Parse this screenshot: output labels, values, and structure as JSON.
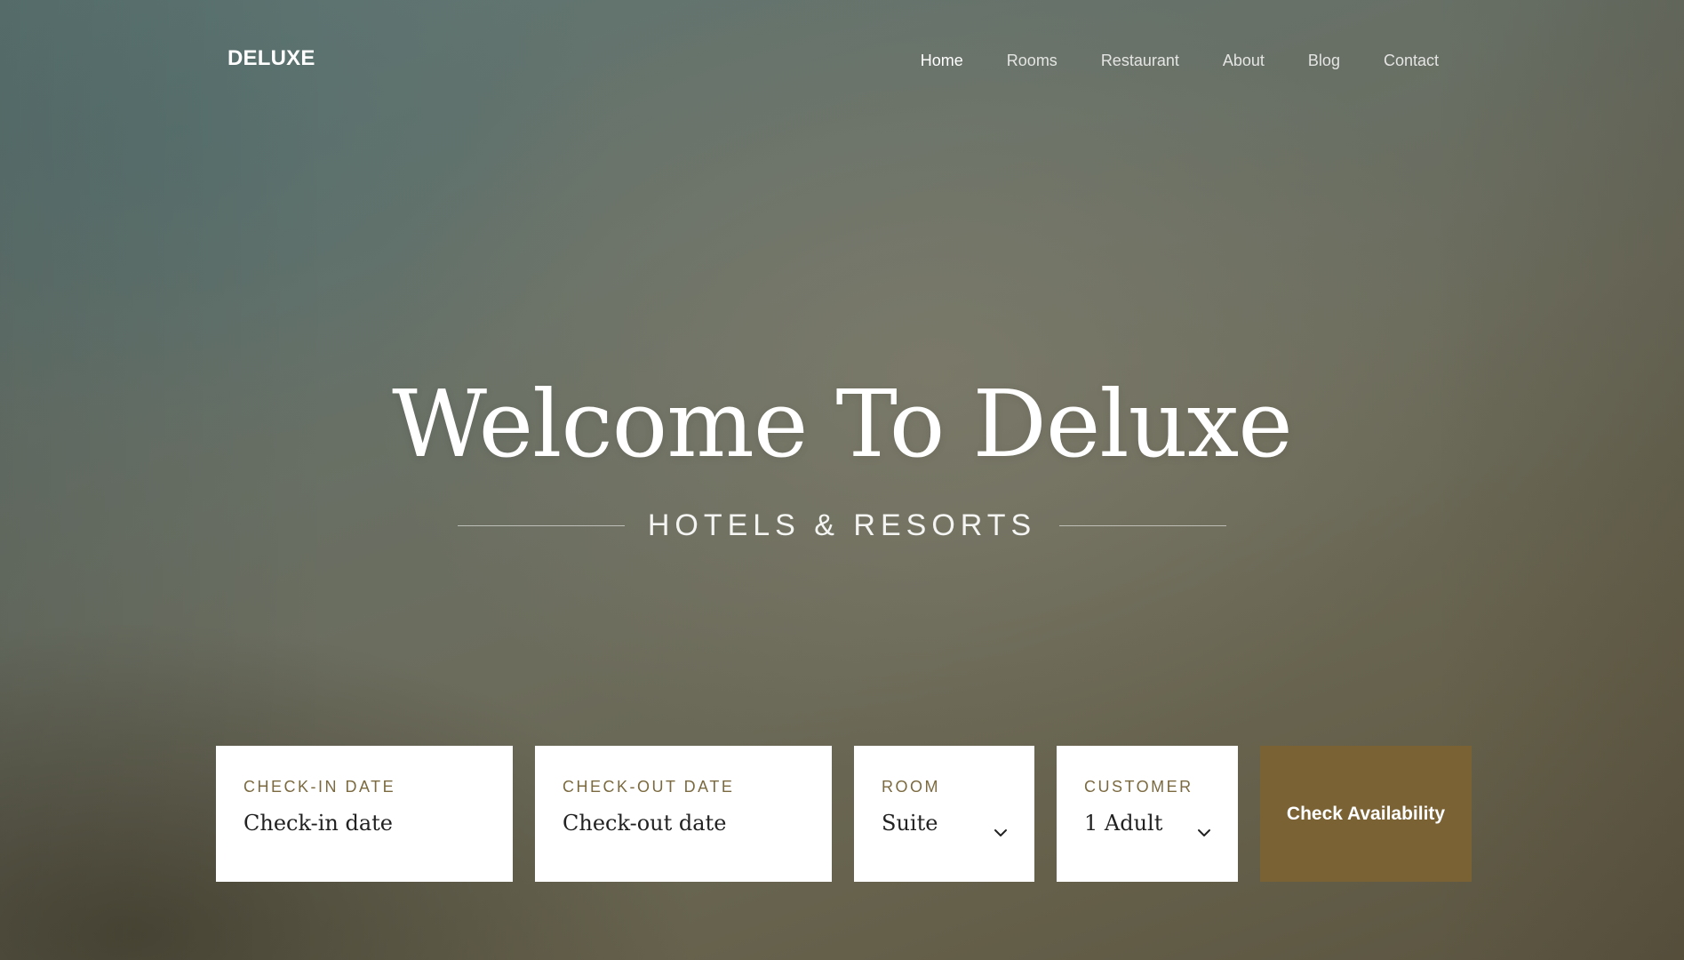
{
  "brand": {
    "logo": "DELUXE"
  },
  "nav": {
    "items": [
      {
        "label": "Home",
        "active": true
      },
      {
        "label": "Rooms",
        "active": false
      },
      {
        "label": "Restaurant",
        "active": false
      },
      {
        "label": "About",
        "active": false
      },
      {
        "label": "Blog",
        "active": false
      },
      {
        "label": "Contact",
        "active": false
      }
    ]
  },
  "hero": {
    "title": "Welcome To Deluxe",
    "subtitle": "HOTELS & RESORTS"
  },
  "booking": {
    "checkin": {
      "label": "CHECK-IN DATE",
      "placeholder": "Check-in date"
    },
    "checkout": {
      "label": "CHECK-OUT DATE",
      "placeholder": "Check-out date"
    },
    "room": {
      "label": "ROOM",
      "value": "Suite",
      "icon": "chevron-down-icon"
    },
    "customer": {
      "label": "CUSTOMER",
      "value": "1 Adult",
      "icon": "chevron-down-icon"
    },
    "button_label": "Check Availability"
  },
  "colors": {
    "accent": "#7a6234",
    "label": "#7b6a40",
    "text_light": "#ffffff",
    "field_bg": "#ffffff"
  }
}
